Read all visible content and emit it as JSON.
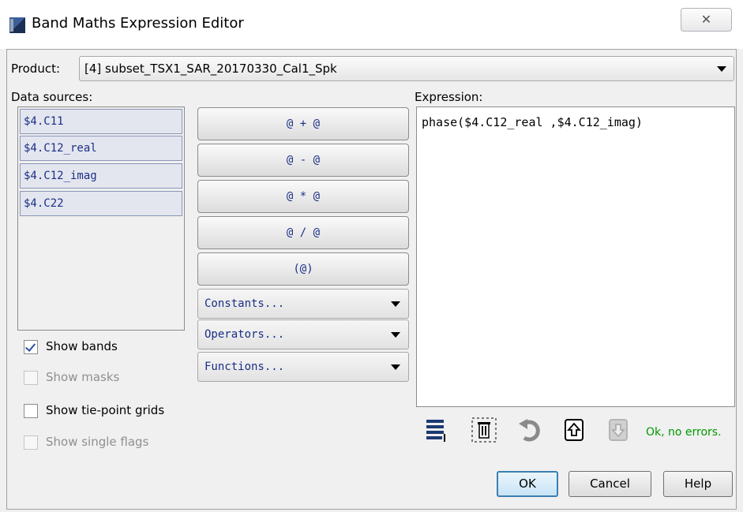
{
  "window": {
    "title": "Band Maths Expression Editor",
    "close_glyph": "✕"
  },
  "product": {
    "label": "Product:",
    "value": "[4] subset_TSX1_SAR_20170330_Cal1_Spk"
  },
  "data_sources": {
    "label": "Data sources:",
    "items": [
      "$4.C11",
      "$4.C12_real",
      "$4.C12_imag",
      "$4.C22"
    ]
  },
  "checkboxes": [
    {
      "label": "Show bands",
      "checked": true,
      "enabled": true
    },
    {
      "label": "Show masks",
      "checked": false,
      "enabled": false
    },
    {
      "label": "Show tie-point grids",
      "checked": false,
      "enabled": true
    },
    {
      "label": "Show single flags",
      "checked": false,
      "enabled": false
    }
  ],
  "operators": {
    "add": "@ + @",
    "sub": "@ - @",
    "mul": "@ * @",
    "div": "@ / @",
    "paren": "(@)"
  },
  "dropdowns": {
    "constants": "Constants...",
    "operators": "Operators...",
    "functions": "Functions..."
  },
  "expression": {
    "label": "Expression:",
    "value": "phase($4.C12_real ,$4.C12_imag)"
  },
  "toolbar": {
    "icons": [
      "history-icon",
      "clear-icon",
      "undo-icon",
      "import-icon",
      "export-icon"
    ]
  },
  "status": {
    "text": "Ok, no errors.",
    "color": "#009900"
  },
  "buttons": {
    "ok": "OK",
    "cancel": "Cancel",
    "help": "Help"
  }
}
